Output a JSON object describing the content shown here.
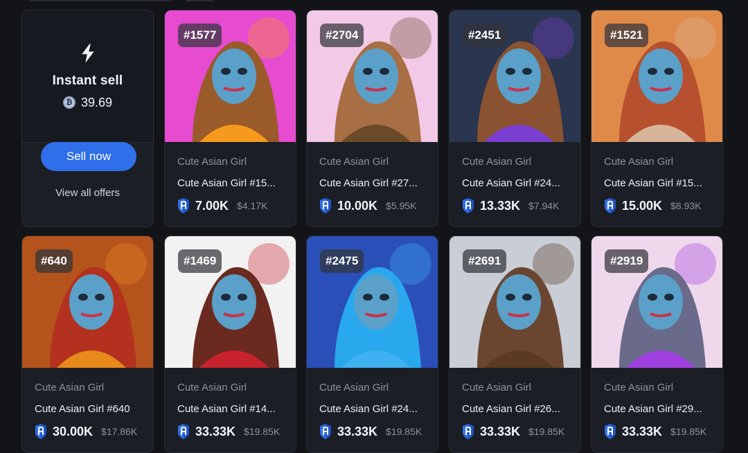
{
  "instant_sell": {
    "title": "Instant sell",
    "amount": "39.69",
    "sell_button": "Sell now",
    "view_all": "View all offers"
  },
  "items": [
    {
      "badge": "#1577",
      "collection": "Cute Asian Girl",
      "name": "Cute Asian Girl #15...",
      "price": "7.00K",
      "usd": "$4.17K",
      "bg": "#e64bd0",
      "accent": "#f59a1c",
      "hair": "#9a5a2a"
    },
    {
      "badge": "#2704",
      "collection": "Cute Asian Girl",
      "name": "Cute Asian Girl #27...",
      "price": "10.00K",
      "usd": "$5.95K",
      "bg": "#f2c9e6",
      "accent": "#6b4a2a",
      "hair": "#a86e44"
    },
    {
      "badge": "#2451",
      "collection": "Cute Asian Girl",
      "name": "Cute Asian Girl #24...",
      "price": "13.33K",
      "usd": "$7.94K",
      "bg": "#2a3550",
      "accent": "#7a3fd0",
      "hair": "#8a5230"
    },
    {
      "badge": "#1521",
      "collection": "Cute Asian Girl",
      "name": "Cute Asian Girl #15...",
      "price": "15.00K",
      "usd": "$8.93K",
      "bg": "#e08a4a",
      "accent": "#d7b49a",
      "hair": "#b6502e"
    },
    {
      "badge": "#640",
      "collection": "Cute Asian Girl",
      "name": "Cute Asian Girl #640",
      "price": "30.00K",
      "usd": "$17.86K",
      "bg": "#b5531c",
      "accent": "#e8891c",
      "hair": "#b3311e"
    },
    {
      "badge": "#1469",
      "collection": "Cute Asian Girl",
      "name": "Cute Asian Girl #14...",
      "price": "33.33K",
      "usd": "$19.85K",
      "bg": "#f2f2f2",
      "accent": "#c8232c",
      "hair": "#6a2a20"
    },
    {
      "badge": "#2475",
      "collection": "Cute Asian Girl",
      "name": "Cute Asian Girl #24...",
      "price": "33.33K",
      "usd": "$19.85K",
      "bg": "#2a4fb8",
      "accent": "#3fb0f0",
      "hair": "#2aa8ee"
    },
    {
      "badge": "#2691",
      "collection": "Cute Asian Girl",
      "name": "Cute Asian Girl #26...",
      "price": "33.33K",
      "usd": "$19.85K",
      "bg": "#c8cdd6",
      "accent": "#5a3a22",
      "hair": "#6a4630"
    },
    {
      "badge": "#2919",
      "collection": "Cute Asian Girl",
      "name": "Cute Asian Girl #29...",
      "price": "33.33K",
      "usd": "$19.85K",
      "bg": "#f0d8ec",
      "accent": "#a040e0",
      "hair": "#6a6a8a"
    }
  ],
  "colors": {
    "page_bg": "#121418",
    "card_bg": "#1b1e25",
    "button_blue": "#2f6fe9",
    "shield_blue": "#2f6fe9",
    "muted_text": "#8d93a0"
  },
  "icons": {
    "instant": "lightning-bolt-icon",
    "coin": "coin-icon",
    "price": "token-shield-icon"
  }
}
